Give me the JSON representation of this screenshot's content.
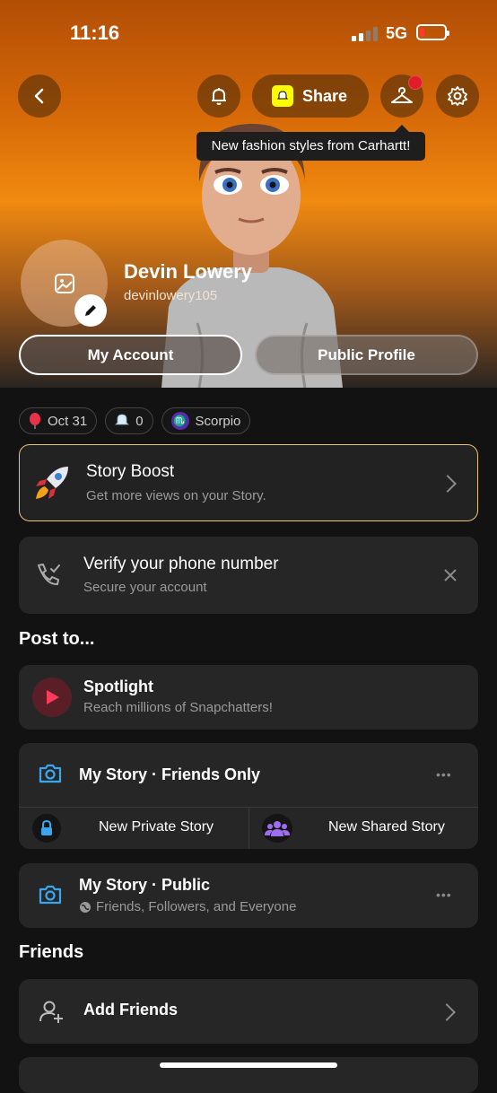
{
  "status_bar": {
    "time": "11:16",
    "network": "5G"
  },
  "header": {
    "share_label": "Share",
    "tooltip": "New fashion styles from Carhartt!",
    "name": "Devin Lowery",
    "username": "devinlowery105",
    "my_account_label": "My Account",
    "public_profile_label": "Public Profile"
  },
  "chips": [
    {
      "icon": "balloon-icon",
      "label": "Oct 31"
    },
    {
      "icon": "ghost-icon",
      "label": "0"
    },
    {
      "icon": "scorpio-icon",
      "label": "Scorpio"
    }
  ],
  "story_boost": {
    "title": "Story Boost",
    "subtitle": "Get more views on your Story."
  },
  "verify": {
    "title": "Verify your phone number",
    "subtitle": "Secure your account"
  },
  "post_to": {
    "heading": "Post to...",
    "spotlight": {
      "title": "Spotlight",
      "subtitle": "Reach millions of Snapchatters!"
    },
    "my_story_friends": "My Story · Friends Only",
    "new_private_story": "New Private Story",
    "new_shared_story": "New Shared Story",
    "my_story_public": {
      "title": "My Story · Public",
      "subtitle": "Friends, Followers, and Everyone"
    }
  },
  "friends": {
    "heading": "Friends",
    "add_friends": "Add Friends"
  },
  "colors": {
    "accent_blue": "#38a7f0",
    "boost_border": "#e8c46a",
    "notification_red": "#e11d2a",
    "snap_yellow": "#fffc00"
  }
}
